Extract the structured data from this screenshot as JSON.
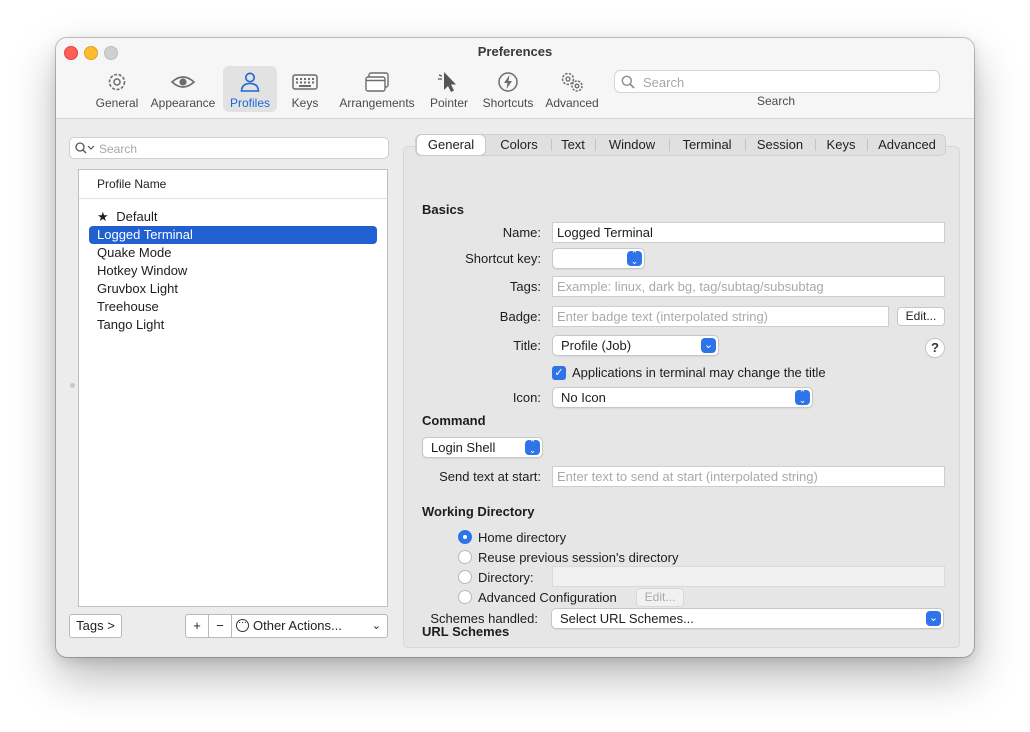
{
  "window": {
    "title": "Preferences"
  },
  "toolbar": {
    "items": [
      {
        "label": "General",
        "icon": "gear-icon"
      },
      {
        "label": "Appearance",
        "icon": "eye-icon"
      },
      {
        "label": "Profiles",
        "icon": "person-icon",
        "active": true
      },
      {
        "label": "Keys",
        "icon": "keyboard-icon"
      },
      {
        "label": "Arrangements",
        "icon": "windows-icon"
      },
      {
        "label": "Pointer",
        "icon": "pointer-icon"
      },
      {
        "label": "Shortcuts",
        "icon": "bolt-icon"
      },
      {
        "label": "Advanced",
        "icon": "gears-icon"
      }
    ],
    "search": {
      "placeholder": "Search",
      "caption": "Search"
    }
  },
  "profiles": {
    "search_placeholder": "Search",
    "column_header": "Profile Name",
    "items": [
      {
        "name": "Default",
        "is_default": true,
        "star": "★"
      },
      {
        "name": "Logged Terminal",
        "selected": true
      },
      {
        "name": "Quake Mode"
      },
      {
        "name": "Hotkey Window"
      },
      {
        "name": "Gruvbox Light"
      },
      {
        "name": "Treehouse"
      },
      {
        "name": "Tango Light"
      }
    ],
    "tags_button": "Tags >",
    "add_button": "+",
    "remove_button": "−",
    "other_actions": "Other Actions..."
  },
  "tabs": [
    "General",
    "Colors",
    "Text",
    "Window",
    "Terminal",
    "Session",
    "Keys",
    "Advanced"
  ],
  "general": {
    "basics_title": "Basics",
    "name_label": "Name:",
    "name_value": "Logged Terminal",
    "shortcut_label": "Shortcut key:",
    "shortcut_value": "",
    "tags_label": "Tags:",
    "tags_placeholder": "Example: linux, dark bg, tag/subtag/subsubtag",
    "badge_label": "Badge:",
    "badge_placeholder": "Enter badge text (interpolated string)",
    "badge_edit": "Edit...",
    "title_label": "Title:",
    "title_value": "Profile (Job)",
    "help": "?",
    "apps_change_title_label": "Applications in terminal may change the title",
    "apps_change_title_checked": true,
    "icon_label": "Icon:",
    "icon_value": "No Icon",
    "command_title": "Command",
    "command_value": "Login Shell",
    "send_text_label": "Send text at start:",
    "send_text_placeholder": "Enter text to send at start (interpolated string)",
    "working_dir_title": "Working Directory",
    "wd_home": "Home directory",
    "wd_reuse": "Reuse previous session's directory",
    "wd_directory": "Directory:",
    "wd_advanced": "Advanced Configuration",
    "wd_advanced_edit": "Edit...",
    "wd_selected": "home",
    "url_title": "URL Schemes",
    "schemes_label": "Schemes handled:",
    "schemes_value": "Select URL Schemes..."
  },
  "colors": {
    "accent": "#2d74e8",
    "selection": "#2160d0"
  }
}
